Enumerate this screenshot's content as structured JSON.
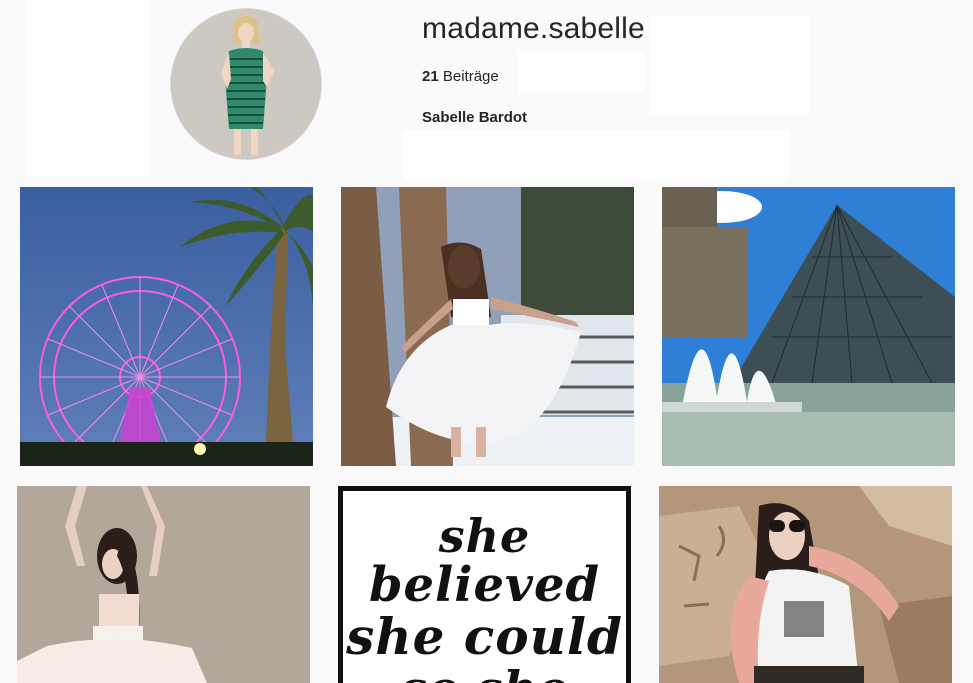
{
  "profile": {
    "username": "madame.sabelle",
    "posts_count": "21",
    "posts_label": "Beiträge",
    "full_name": "Sabelle Bardot"
  },
  "posts": [
    {
      "name": "post-ferris-wheel-palm"
    },
    {
      "name": "post-tutu-winter-tree"
    },
    {
      "name": "post-louvre-pyramid"
    },
    {
      "name": "post-dancer-wall"
    },
    {
      "name": "post-quote",
      "quote_lines": [
        "she",
        "believed",
        "she could",
        "so she"
      ]
    },
    {
      "name": "post-sunglasses-ruins"
    }
  ]
}
